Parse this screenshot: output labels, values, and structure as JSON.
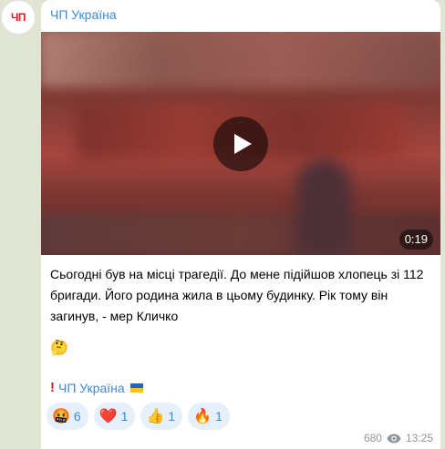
{
  "channel": {
    "avatar_text": "ЧП",
    "name": "ЧП Україна"
  },
  "video": {
    "duration": "0:19"
  },
  "message": {
    "text": "Сьогодні був на місці трагедії. До мене підійшов хлопець зі 112 бригади. Його родина жила в цьому будинку. Рік тому він загинув, - мер Кличко",
    "emoji": "🤔",
    "signature": "ЧП Україна"
  },
  "reactions": [
    {
      "emoji": "🤬",
      "count": "6"
    },
    {
      "emoji": "❤️",
      "count": "1"
    },
    {
      "emoji": "👍",
      "count": "1"
    },
    {
      "emoji": "🔥",
      "count": "1"
    }
  ],
  "meta": {
    "views": "680",
    "time": "13:25"
  },
  "colors": {
    "accent": "#3b8bd3",
    "brand_red": "#d71920",
    "background": "#dfe5d2"
  }
}
